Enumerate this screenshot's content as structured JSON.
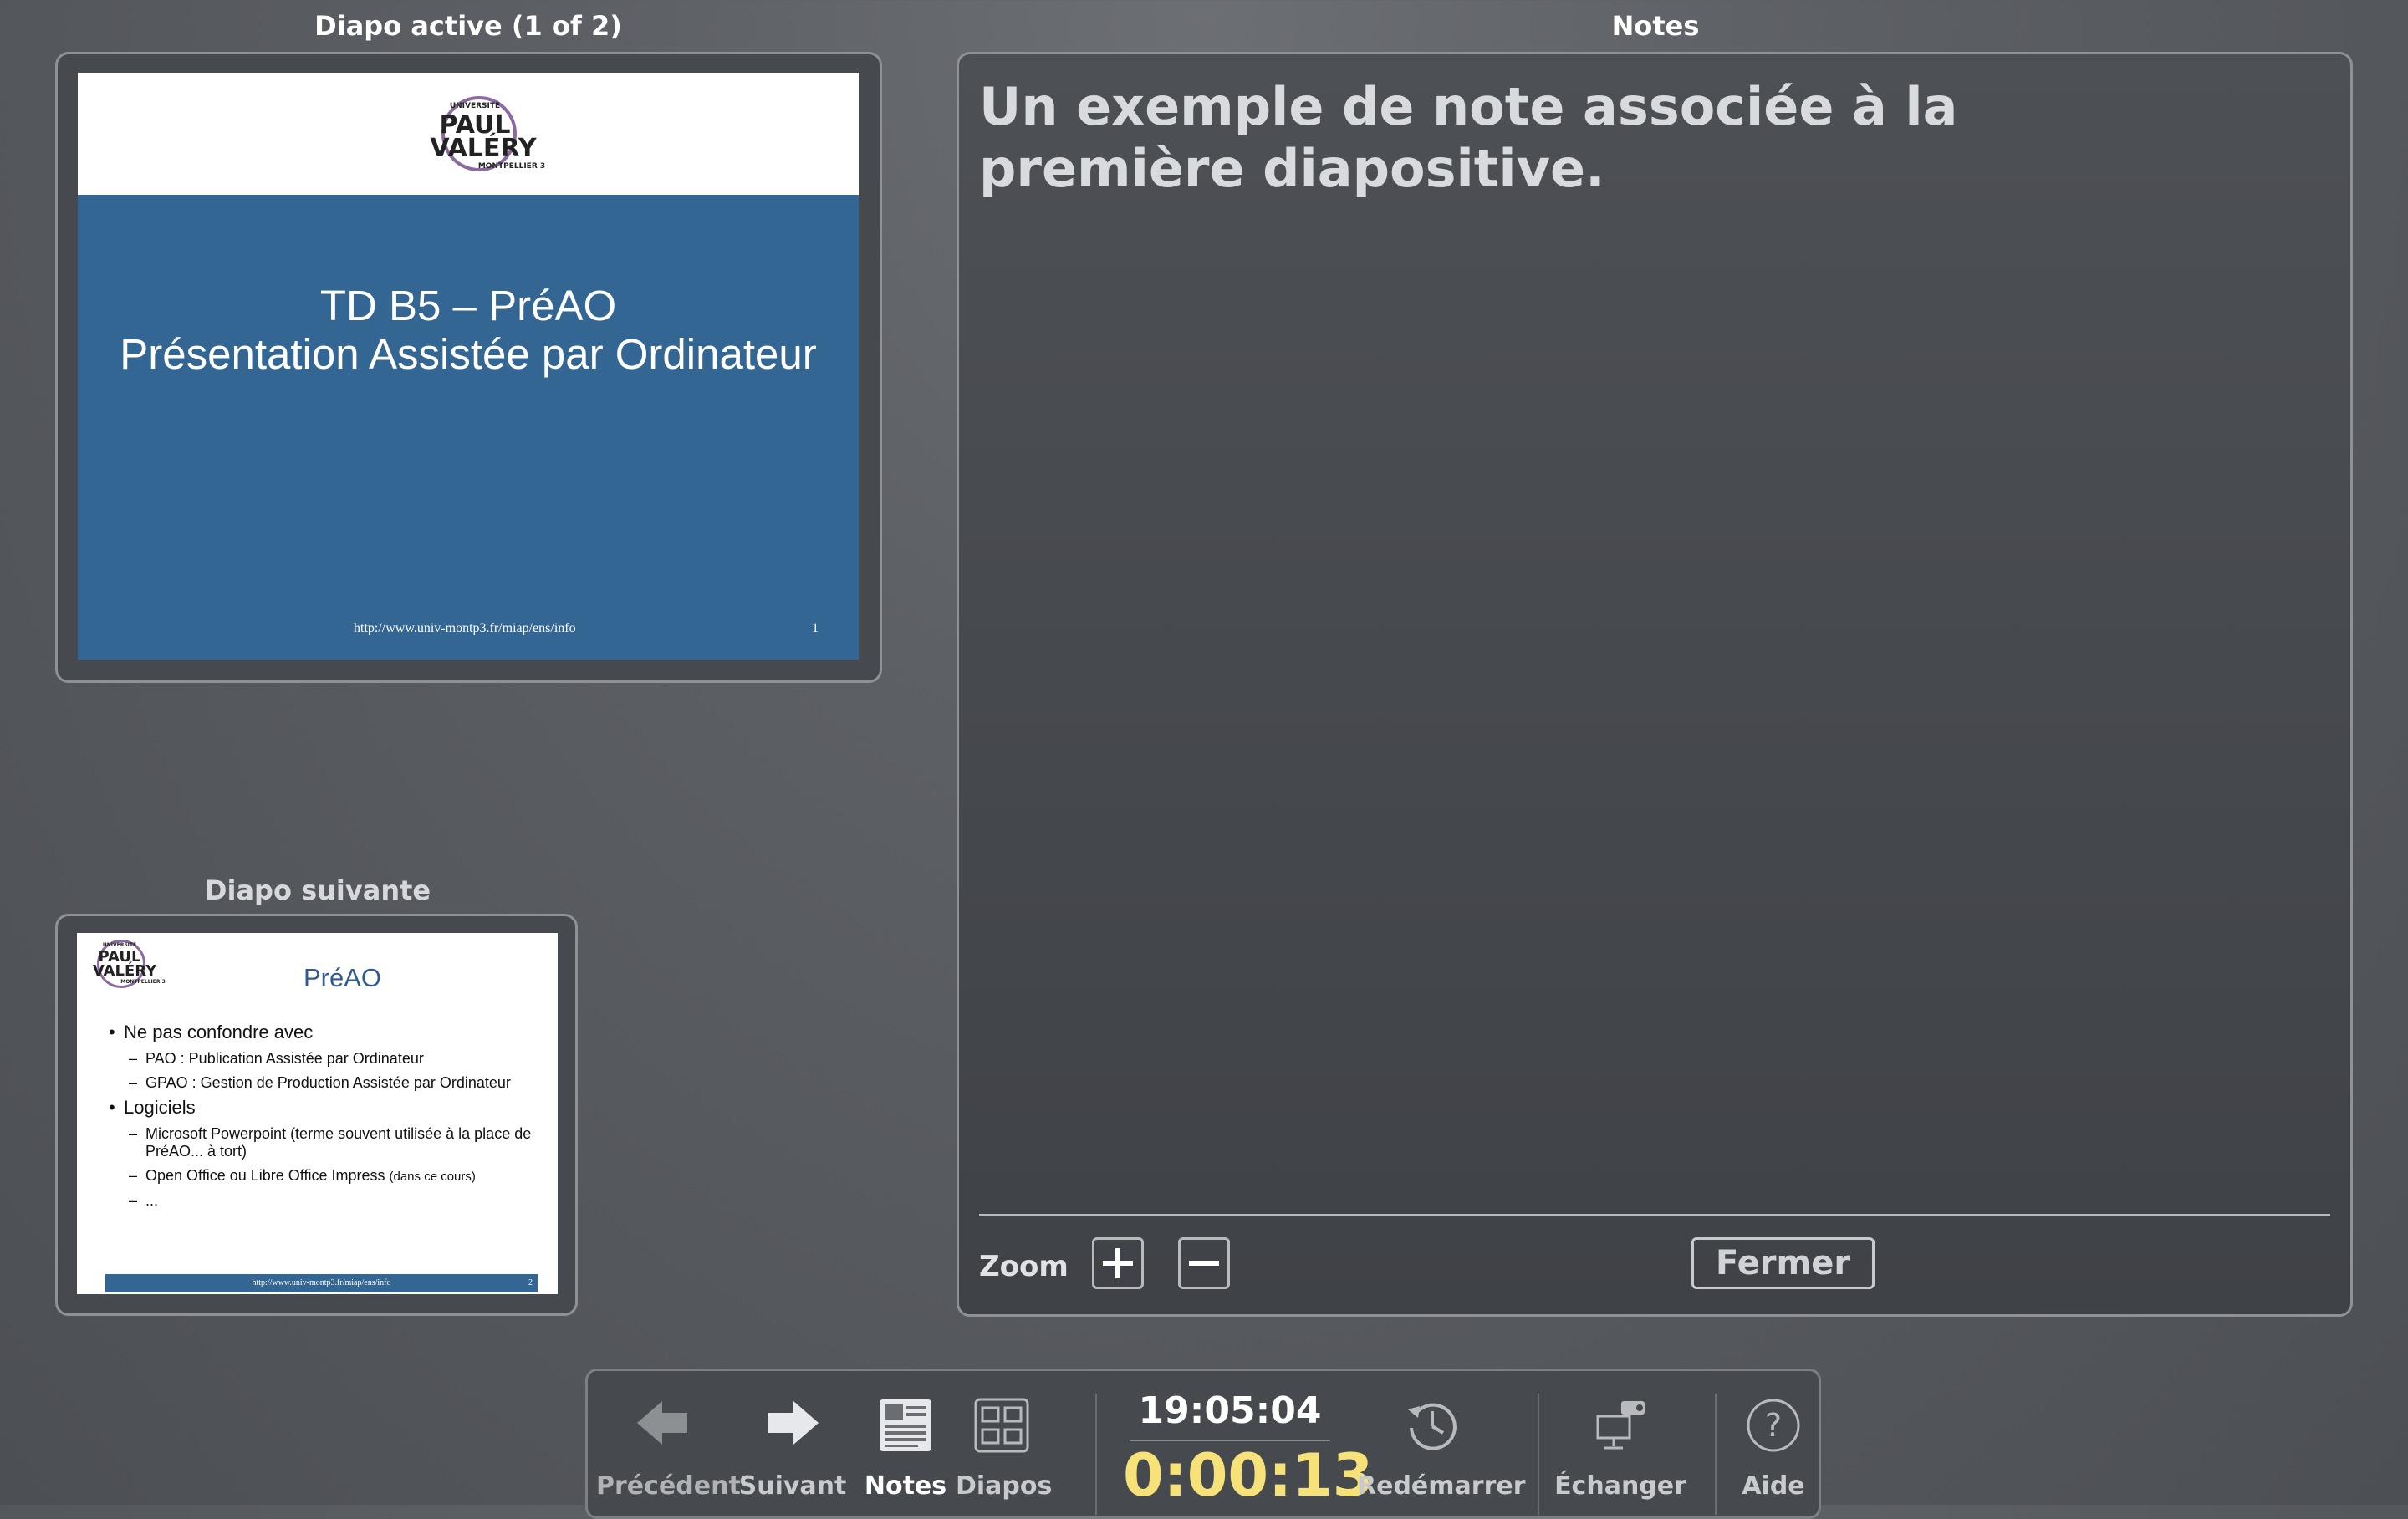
{
  "active_slide": {
    "label": "Diapo active (1 of 2)",
    "logo": {
      "top": "UNIVERSITÉ",
      "line1": "PAUL",
      "line2": "VALÉRY",
      "bottom": "MONTPELLIER 3"
    },
    "title_line1": "TD B5 – PréAO",
    "title_line2": "Présentation Assistée par Ordinateur",
    "footer_url": "http://www.univ-montp3.fr/miap/ens/info",
    "footer_number": "1"
  },
  "next_slide": {
    "label": "Diapo suivante",
    "title": "PréAO",
    "bullets": {
      "b1": "Ne pas confondre avec",
      "b1_s1": "PAO : Publication Assistée par Ordinateur",
      "b1_s2": "GPAO : Gestion de Production Assistée par Ordinateur",
      "b2": "Logiciels",
      "b2_s1": "Microsoft Powerpoint (terme souvent utilisée à la place de PréAO... à tort)",
      "b2_s2": "Open Office ou Libre Office Impress",
      "b2_s2_small": "(dans ce cours)",
      "b2_s3": "..."
    },
    "footer_url": "http://www.univ-montp3.fr/miap/ens/info",
    "footer_number": "2"
  },
  "notes": {
    "label": "Notes",
    "text": "Un exemple de note associée à la première diapositive.",
    "zoom_label": "Zoom",
    "close_label": "Fermer"
  },
  "toolbar": {
    "previous": "Précédent",
    "next": "Suivant",
    "notes": "Notes",
    "slides": "Diapos",
    "clock": "19:05:04",
    "timer": "0:00:13",
    "restart": "Redémarrer",
    "swap": "Échanger",
    "help": "Aide"
  },
  "colors": {
    "slide_blue": "#346693",
    "timer_yellow": "#f7e27a",
    "logo_purple": "#7a4d8f"
  }
}
